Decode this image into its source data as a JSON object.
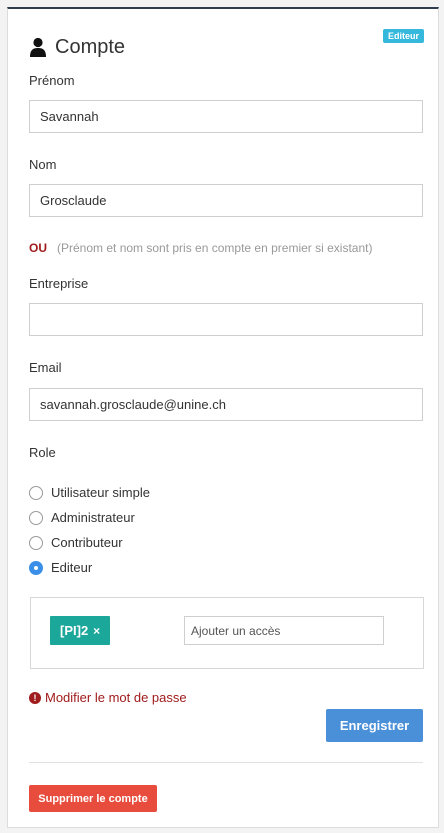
{
  "header": {
    "title": "Compte",
    "icon": "user-icon",
    "badge": "Editeur",
    "badge_color": "#36b8dc"
  },
  "form": {
    "first_name": {
      "label": "Prénom",
      "value": "Savannah"
    },
    "last_name": {
      "label": "Nom",
      "value": "Grosclaude"
    },
    "or_word": "OU",
    "or_note": "(Prénom et nom sont pris en compte en premier si existant)",
    "company": {
      "label": "Entreprise",
      "value": ""
    },
    "email": {
      "label": "Email",
      "value": "savannah.grosclaude@unine.ch"
    },
    "role": {
      "label": "Role",
      "options": [
        {
          "label": "Utilisateur simple",
          "checked": false
        },
        {
          "label": "Administrateur",
          "checked": false
        },
        {
          "label": "Contributeur",
          "checked": false
        },
        {
          "label": "Editeur",
          "checked": true
        }
      ]
    },
    "access": {
      "tags": [
        {
          "label": "[PI]2",
          "close": "×"
        }
      ],
      "input_placeholder": "Ajouter un accès",
      "tag_color": "#1ba79a"
    }
  },
  "actions": {
    "change_password": "Modifier le mot de passe",
    "alert_glyph": "!",
    "save": "Enregistrer",
    "delete": "Supprimer le compte"
  },
  "colors": {
    "primary": "#4a90d9",
    "danger": "#e74c3c",
    "dark_red": "#a01c1c"
  }
}
